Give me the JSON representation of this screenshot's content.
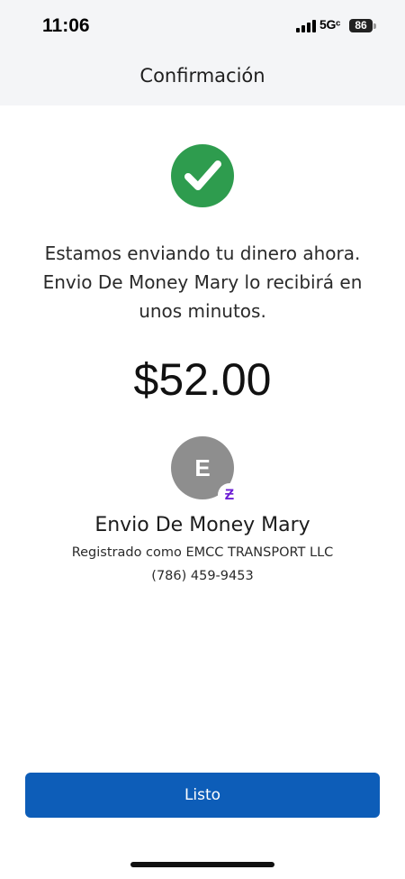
{
  "status_bar": {
    "time": "11:06",
    "network": "5Gᶜ",
    "battery": "86"
  },
  "header": {
    "title": "Confirmación"
  },
  "confirmation": {
    "status_icon": "check-circle-icon",
    "message": "Estamos enviando tu dinero ahora. Envio De Money Mary lo recibirá en unos minutos.",
    "amount": "$52.00"
  },
  "recipient": {
    "avatar_initial": "E",
    "badge_icon": "zelle-icon",
    "name": "Envio De Money Mary",
    "registered_as": "Registrado como EMCC TRANSPORT LLC",
    "phone": "(786) 459-9453"
  },
  "actions": {
    "done_label": "Listo"
  },
  "colors": {
    "header_bg": "#f4f5f7",
    "success_green": "#2e9c4e",
    "button_blue": "#0d5db8",
    "zelle_purple": "#6d1ed4",
    "avatar_gray": "#8e8e8e"
  }
}
